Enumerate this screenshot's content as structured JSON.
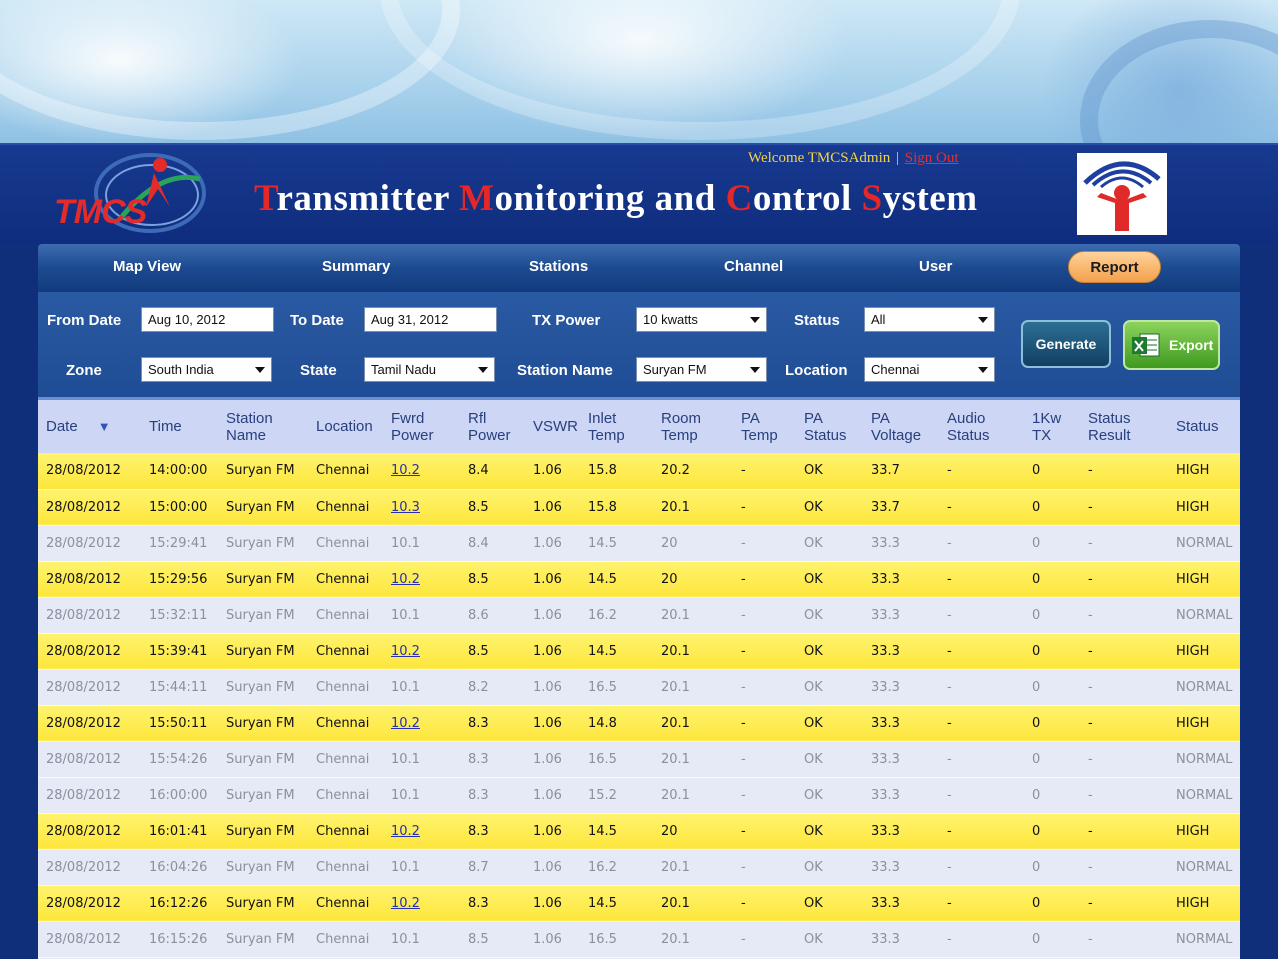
{
  "header": {
    "welcome_text": "Welcome TMCSAdmin",
    "separator": "|",
    "signout_label": "Sign Out",
    "logo_text": "TMCS",
    "title_parts": [
      {
        "cap": "T",
        "rest": "ransmitter "
      },
      {
        "cap": "M",
        "rest": "onitoring and "
      },
      {
        "cap": "C",
        "rest": "ontrol "
      },
      {
        "cap": "S",
        "rest": "ystem"
      }
    ]
  },
  "nav": {
    "items": [
      "Map View",
      "Summary",
      "Stations",
      "Channel",
      "User"
    ],
    "report_label": "Report"
  },
  "filters": {
    "from_date_label": "From Date",
    "from_date_value": "Aug 10, 2012",
    "to_date_label": "To Date",
    "to_date_value": "Aug 31, 2012",
    "tx_power_label": "TX Power",
    "tx_power_value": "10 kwatts",
    "status_label": "Status",
    "status_value": "All",
    "zone_label": "Zone",
    "zone_value": "South India",
    "state_label": "State",
    "state_value": "Tamil Nadu",
    "station_name_label": "Station Name",
    "station_name_value": "Suryan FM",
    "location_label": "Location",
    "location_value": "Chennai",
    "generate_label": "Generate",
    "export_label": "Export"
  },
  "table": {
    "columns": [
      [
        "Date"
      ],
      [
        "Time"
      ],
      [
        "Station",
        "Name"
      ],
      [
        "Location"
      ],
      [
        "Fwrd",
        "Power"
      ],
      [
        "Rfl",
        "Power"
      ],
      [
        "VSWR"
      ],
      [
        "Inlet",
        "Temp"
      ],
      [
        "Room",
        "Temp"
      ],
      [
        "PA",
        "Temp"
      ],
      [
        "PA",
        "Status"
      ],
      [
        "PA",
        "Voltage"
      ],
      [
        "Audio",
        "Status"
      ],
      [
        "1Kw",
        "TX"
      ],
      [
        "Status",
        "Result"
      ],
      [
        "Status"
      ]
    ],
    "rows": [
      {
        "level": "high",
        "cells": [
          "28/08/2012",
          "14:00:00",
          "Suryan FM",
          "Chennai",
          "10.2",
          "8.4",
          "1.06",
          "15.8",
          "20.2",
          "-",
          "OK",
          "33.7",
          "-",
          "0",
          "-",
          "HIGH"
        ]
      },
      {
        "level": "high",
        "cells": [
          "28/08/2012",
          "15:00:00",
          "Suryan FM",
          "Chennai",
          "10.3",
          "8.5",
          "1.06",
          "15.8",
          "20.1",
          "-",
          "OK",
          "33.7",
          "-",
          "0",
          "-",
          "HIGH"
        ]
      },
      {
        "level": "normal",
        "cells": [
          "28/08/2012",
          "15:29:41",
          "Suryan FM",
          "Chennai",
          "10.1",
          "8.4",
          "1.06",
          "14.5",
          "20",
          "-",
          "OK",
          "33.3",
          "-",
          "0",
          "-",
          "NORMAL"
        ]
      },
      {
        "level": "high",
        "cells": [
          "28/08/2012",
          "15:29:56",
          "Suryan FM",
          "Chennai",
          "10.2",
          "8.5",
          "1.06",
          "14.5",
          "20",
          "-",
          "OK",
          "33.3",
          "-",
          "0",
          "-",
          "HIGH"
        ]
      },
      {
        "level": "normal",
        "cells": [
          "28/08/2012",
          "15:32:11",
          "Suryan FM",
          "Chennai",
          "10.1",
          "8.6",
          "1.06",
          "16.2",
          "20.1",
          "-",
          "OK",
          "33.3",
          "-",
          "0",
          "-",
          "NORMAL"
        ]
      },
      {
        "level": "high",
        "cells": [
          "28/08/2012",
          "15:39:41",
          "Suryan FM",
          "Chennai",
          "10.2",
          "8.5",
          "1.06",
          "14.5",
          "20.1",
          "-",
          "OK",
          "33.3",
          "-",
          "0",
          "-",
          "HIGH"
        ]
      },
      {
        "level": "normal",
        "cells": [
          "28/08/2012",
          "15:44:11",
          "Suryan FM",
          "Chennai",
          "10.1",
          "8.2",
          "1.06",
          "16.5",
          "20.1",
          "-",
          "OK",
          "33.3",
          "-",
          "0",
          "-",
          "NORMAL"
        ]
      },
      {
        "level": "high",
        "cells": [
          "28/08/2012",
          "15:50:11",
          "Suryan FM",
          "Chennai",
          "10.2",
          "8.3",
          "1.06",
          "14.8",
          "20.1",
          "-",
          "OK",
          "33.3",
          "-",
          "0",
          "-",
          "HIGH"
        ]
      },
      {
        "level": "normal",
        "cells": [
          "28/08/2012",
          "15:54:26",
          "Suryan FM",
          "Chennai",
          "10.1",
          "8.3",
          "1.06",
          "16.5",
          "20.1",
          "-",
          "OK",
          "33.3",
          "-",
          "0",
          "-",
          "NORMAL"
        ]
      },
      {
        "level": "normal",
        "cells": [
          "28/08/2012",
          "16:00:00",
          "Suryan FM",
          "Chennai",
          "10.1",
          "8.3",
          "1.06",
          "15.2",
          "20.1",
          "-",
          "OK",
          "33.3",
          "-",
          "0",
          "-",
          "NORMAL"
        ]
      },
      {
        "level": "high",
        "cells": [
          "28/08/2012",
          "16:01:41",
          "Suryan FM",
          "Chennai",
          "10.2",
          "8.3",
          "1.06",
          "14.5",
          "20",
          "-",
          "OK",
          "33.3",
          "-",
          "0",
          "-",
          "HIGH"
        ]
      },
      {
        "level": "normal",
        "cells": [
          "28/08/2012",
          "16:04:26",
          "Suryan FM",
          "Chennai",
          "10.1",
          "8.7",
          "1.06",
          "16.2",
          "20.1",
          "-",
          "OK",
          "33.3",
          "-",
          "0",
          "-",
          "NORMAL"
        ]
      },
      {
        "level": "high",
        "cells": [
          "28/08/2012",
          "16:12:26",
          "Suryan FM",
          "Chennai",
          "10.2",
          "8.3",
          "1.06",
          "14.5",
          "20.1",
          "-",
          "OK",
          "33.3",
          "-",
          "0",
          "-",
          "HIGH"
        ]
      },
      {
        "level": "normal",
        "cells": [
          "28/08/2012",
          "16:15:26",
          "Suryan FM",
          "Chennai",
          "10.1",
          "8.5",
          "1.06",
          "16.5",
          "20.1",
          "-",
          "OK",
          "33.3",
          "-",
          "0",
          "-",
          "NORMAL"
        ]
      }
    ]
  },
  "colors": {
    "header_bg": "#0f2d7e",
    "title_cap": "#e52727",
    "welcome": "#f2d34a",
    "high_row": "#fde63c",
    "normal_row": "#e6e9f6",
    "link": "#2730b0"
  },
  "icons": {
    "sort": "sort-desc-icon",
    "dropdown": "chevron-down-icon",
    "excel": "excel-icon"
  }
}
